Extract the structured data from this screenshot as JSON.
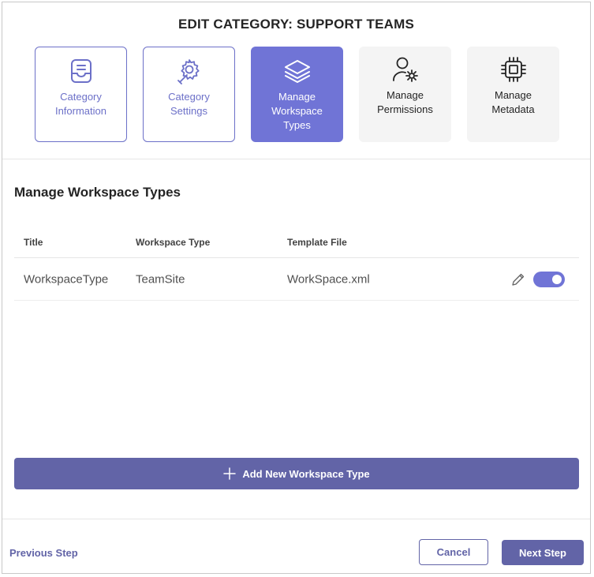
{
  "dialog": {
    "title": "EDIT CATEGORY: SUPPORT TEAMS"
  },
  "steps": [
    {
      "label_lines": [
        "Category",
        "Information"
      ],
      "icon": "inbox-icon",
      "state": "completed"
    },
    {
      "label_lines": [
        "Category",
        "Settings"
      ],
      "icon": "settings-wrench-icon",
      "state": "completed"
    },
    {
      "label_lines": [
        "Manage",
        "Workspace",
        "Types"
      ],
      "icon": "layers-icon",
      "state": "active"
    },
    {
      "label_lines": [
        "Manage",
        "Permissions"
      ],
      "icon": "person-gear-icon",
      "state": "pending"
    },
    {
      "label_lines": [
        "Manage",
        "Metadata"
      ],
      "icon": "chip-icon",
      "state": "pending"
    }
  ],
  "section": {
    "title": "Manage Workspace Types"
  },
  "table": {
    "columns": [
      "Title",
      "Workspace Type",
      "Template File"
    ],
    "rows": [
      {
        "title": "WorkspaceType",
        "workspace_type": "TeamSite",
        "template_file": "WorkSpace.xml",
        "enabled": true
      }
    ]
  },
  "actions": {
    "add_label": "Add New Workspace Type",
    "previous_label": "Previous Step",
    "cancel_label": "Cancel",
    "next_label": "Next Step"
  },
  "colors": {
    "accent": "#6264a7",
    "active_step": "#7074d6",
    "completed_step_border": "#6c70c8",
    "pending_step_bg": "#f4f4f4"
  }
}
